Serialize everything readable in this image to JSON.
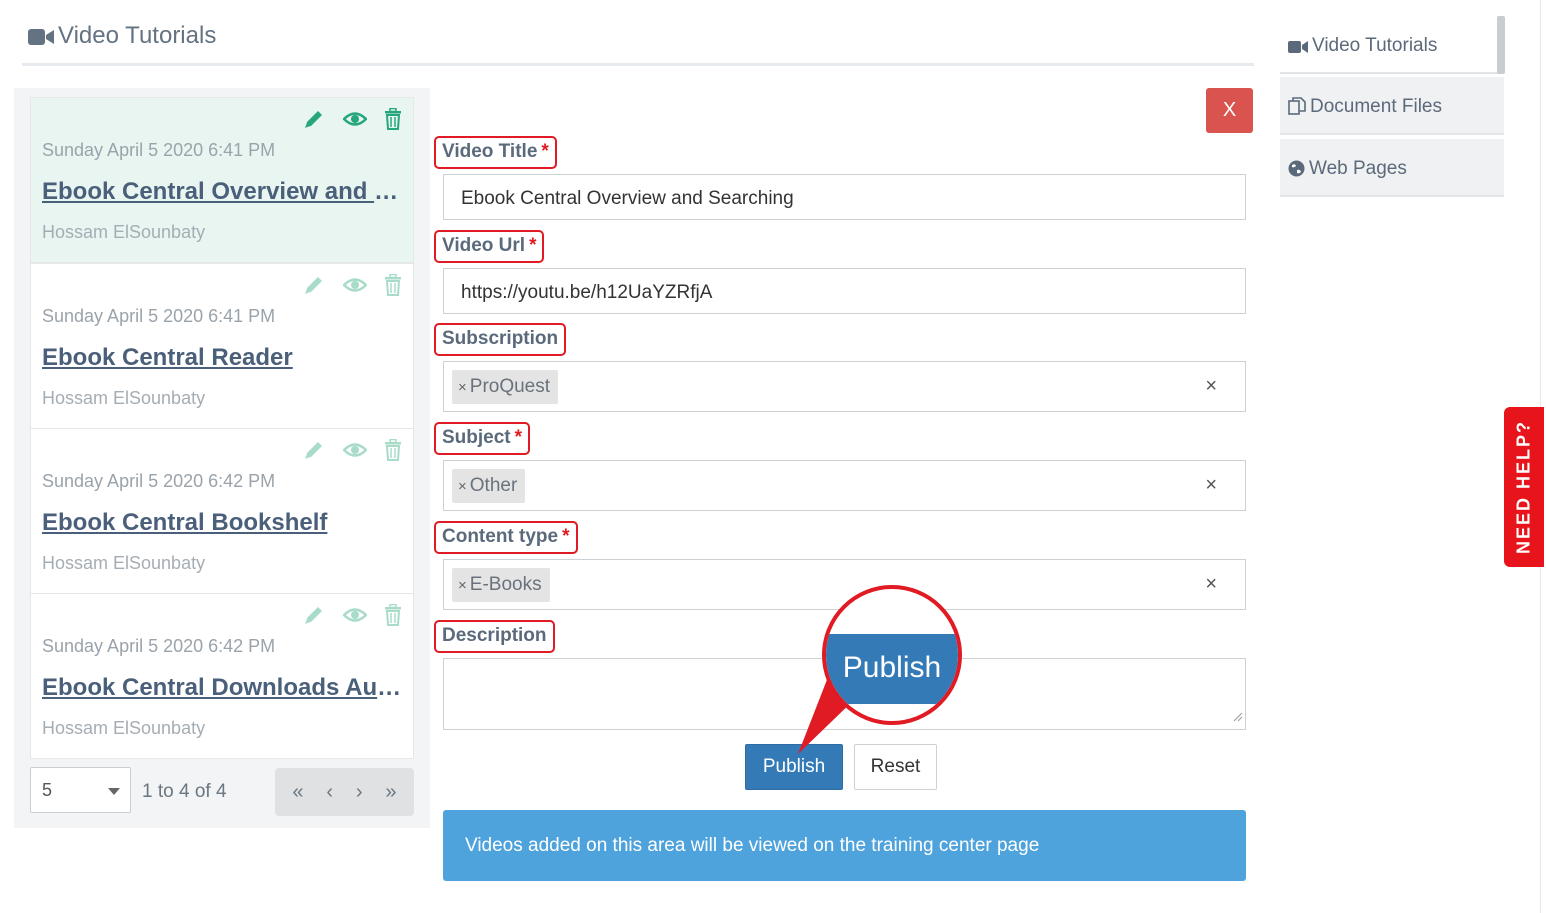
{
  "header": {
    "title": "Video Tutorials",
    "icon": "video-camera-icon"
  },
  "tutorial_list": {
    "items": [
      {
        "date": "Sunday April 5 2020 6:41 PM",
        "title": "Ebook Central Overview and Searching",
        "author": "Hossam ElSounbaty",
        "active": true
      },
      {
        "date": "Sunday April 5 2020 6:41 PM",
        "title": "Ebook Central Reader",
        "author": "Hossam ElSounbaty",
        "active": false
      },
      {
        "date": "Sunday April 5 2020 6:42 PM",
        "title": "Ebook Central Bookshelf",
        "author": "Hossam ElSounbaty",
        "active": false
      },
      {
        "date": "Sunday April 5 2020 6:42 PM",
        "title": "Ebook Central Downloads Australia",
        "author": "Hossam ElSounbaty",
        "active": false
      }
    ],
    "page_size": "5",
    "page_info": "1 to 4 of 4",
    "pager": {
      "first": "«",
      "prev": "‹",
      "next": "›",
      "last": "»"
    }
  },
  "form": {
    "close_label": "X",
    "video_title": {
      "label": "Video Title",
      "required": "*",
      "value": "Ebook Central Overview and Searching"
    },
    "video_url": {
      "label": "Video Url",
      "required": "*",
      "value": "https://youtu.be/h12UaYZRfjA"
    },
    "subscription": {
      "label": "Subscription",
      "tag": "ProQuest",
      "remove": "×",
      "clear": "×"
    },
    "subject": {
      "label": "Subject",
      "required": "*",
      "tag": "Other",
      "remove": "×",
      "clear": "×"
    },
    "content_type": {
      "label": "Content type",
      "required": "*",
      "tag": "E-Books",
      "remove": "×",
      "clear": "×"
    },
    "description": {
      "label": "Description",
      "value": ""
    },
    "publish_label": "Publish",
    "reset_label": "Reset",
    "info_text": "Videos added on this area will be viewed on the training center page"
  },
  "callout": {
    "text": "Publish"
  },
  "side_nav": {
    "items": [
      {
        "label": "Video Tutorials",
        "icon": "video-camera-icon",
        "active": true
      },
      {
        "label": "Document Files",
        "icon": "copy-files-icon",
        "active": false
      },
      {
        "label": "Web Pages",
        "icon": "globe-icon",
        "active": false
      }
    ]
  },
  "help_tab": {
    "label": "NEED HELP?"
  },
  "colors": {
    "accent_red": "#e01b24",
    "primary_blue": "#337ab7",
    "info_blue": "#4ea3dd",
    "icon_green": "#26a67d",
    "danger": "#d9534f"
  }
}
